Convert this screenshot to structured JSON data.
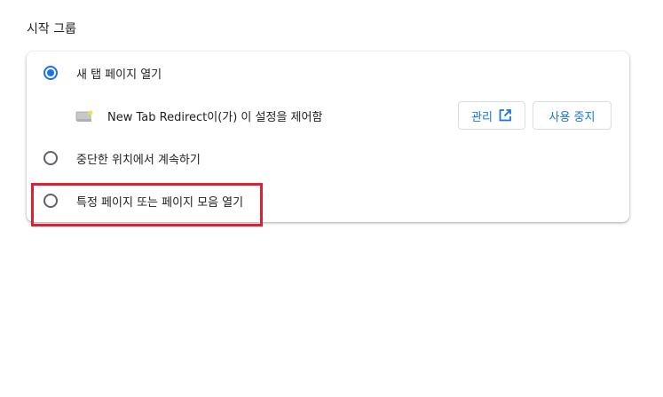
{
  "section": {
    "title": "시작 그룹"
  },
  "options": [
    {
      "label": "새 탭 페이지 열기",
      "selected": true
    },
    {
      "label": "중단한 위치에서 계속하기",
      "selected": false
    },
    {
      "label": "특정 페이지 또는 페이지 모음 열기",
      "selected": false
    }
  ],
  "extension_notice": {
    "text": "New Tab Redirect이(가) 이 설정을 제어함",
    "manage_label": "관리",
    "disable_label": "사용 중지"
  },
  "colors": {
    "accent": "#1a73e8",
    "highlight": "#e02030"
  }
}
